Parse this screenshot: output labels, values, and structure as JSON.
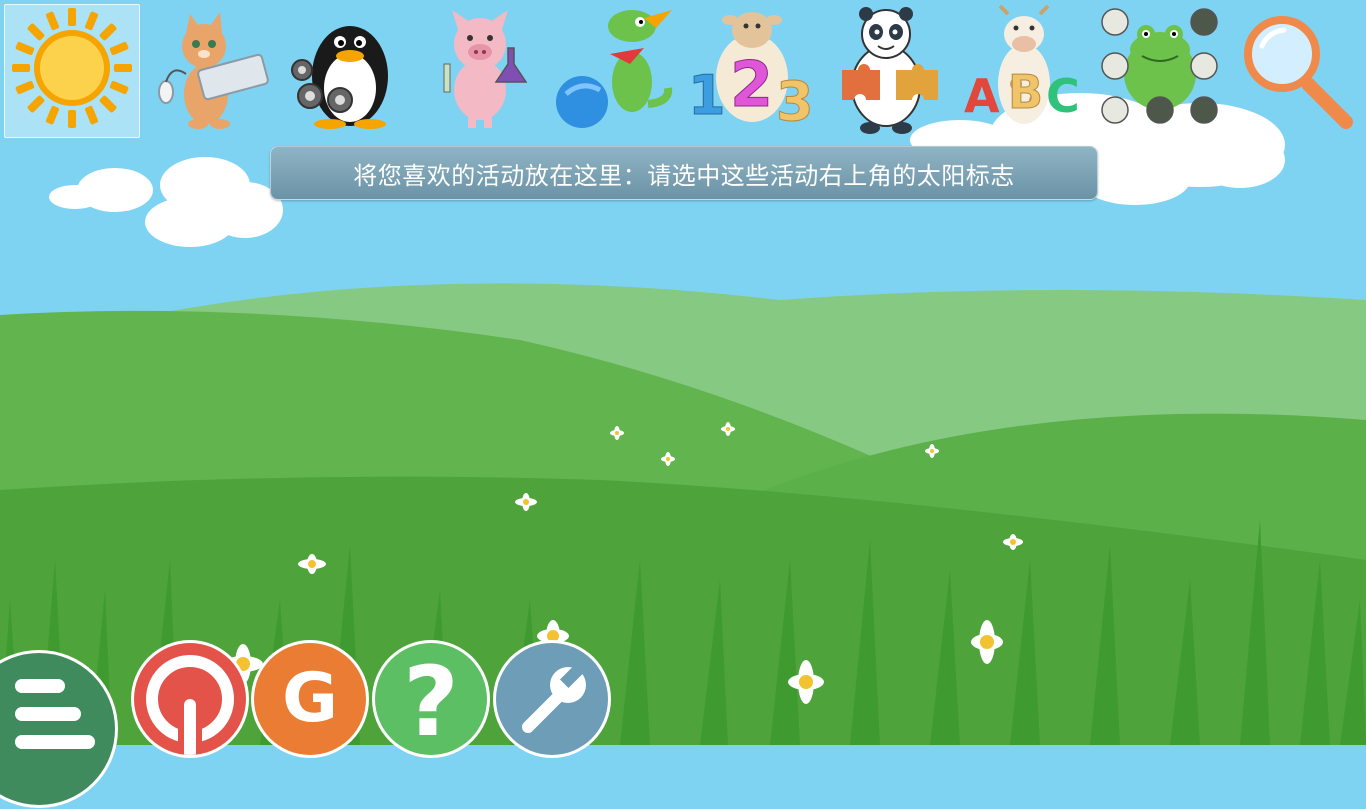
{
  "banner": {
    "text": "将您喜欢的活动放在这里：请选中这些活动右上角的太阳标志"
  },
  "categories": [
    {
      "id": "favorites",
      "icon": "sun-icon",
      "selected": true
    },
    {
      "id": "computer",
      "icon": "cat-keyboard-icon",
      "selected": false
    },
    {
      "id": "discovery",
      "icon": "penguin-gears-icon",
      "selected": false
    },
    {
      "id": "experiment",
      "icon": "pig-flask-icon",
      "selected": false
    },
    {
      "id": "fun",
      "icon": "dragon-ball-icon",
      "selected": false
    },
    {
      "id": "math",
      "icon": "sheep-123-icon",
      "selected": false
    },
    {
      "id": "puzzle",
      "icon": "panda-puzzle-icon",
      "selected": false
    },
    {
      "id": "reading",
      "icon": "cow-abc-icon",
      "selected": false
    },
    {
      "id": "strategy",
      "icon": "frog-board-icon",
      "selected": false
    },
    {
      "id": "search",
      "icon": "magnifier-icon",
      "selected": false
    }
  ],
  "bottom_bar": [
    {
      "id": "menu",
      "icon": "hamburger-menu-icon",
      "color": "#3f8b5e"
    },
    {
      "id": "quit",
      "icon": "power-icon",
      "color": "#e4534a"
    },
    {
      "id": "about",
      "icon": "gcompris-g-icon",
      "color": "#ea7d33"
    },
    {
      "id": "help",
      "icon": "question-icon",
      "color": "#5cbf63"
    },
    {
      "id": "settings",
      "icon": "wrench-icon",
      "color": "#6e9db8"
    }
  ],
  "colors": {
    "sky": "#7fd3f2",
    "hill_far": "#86c983",
    "hill_mid": "#62b44e",
    "grass": "#4ea33b"
  }
}
